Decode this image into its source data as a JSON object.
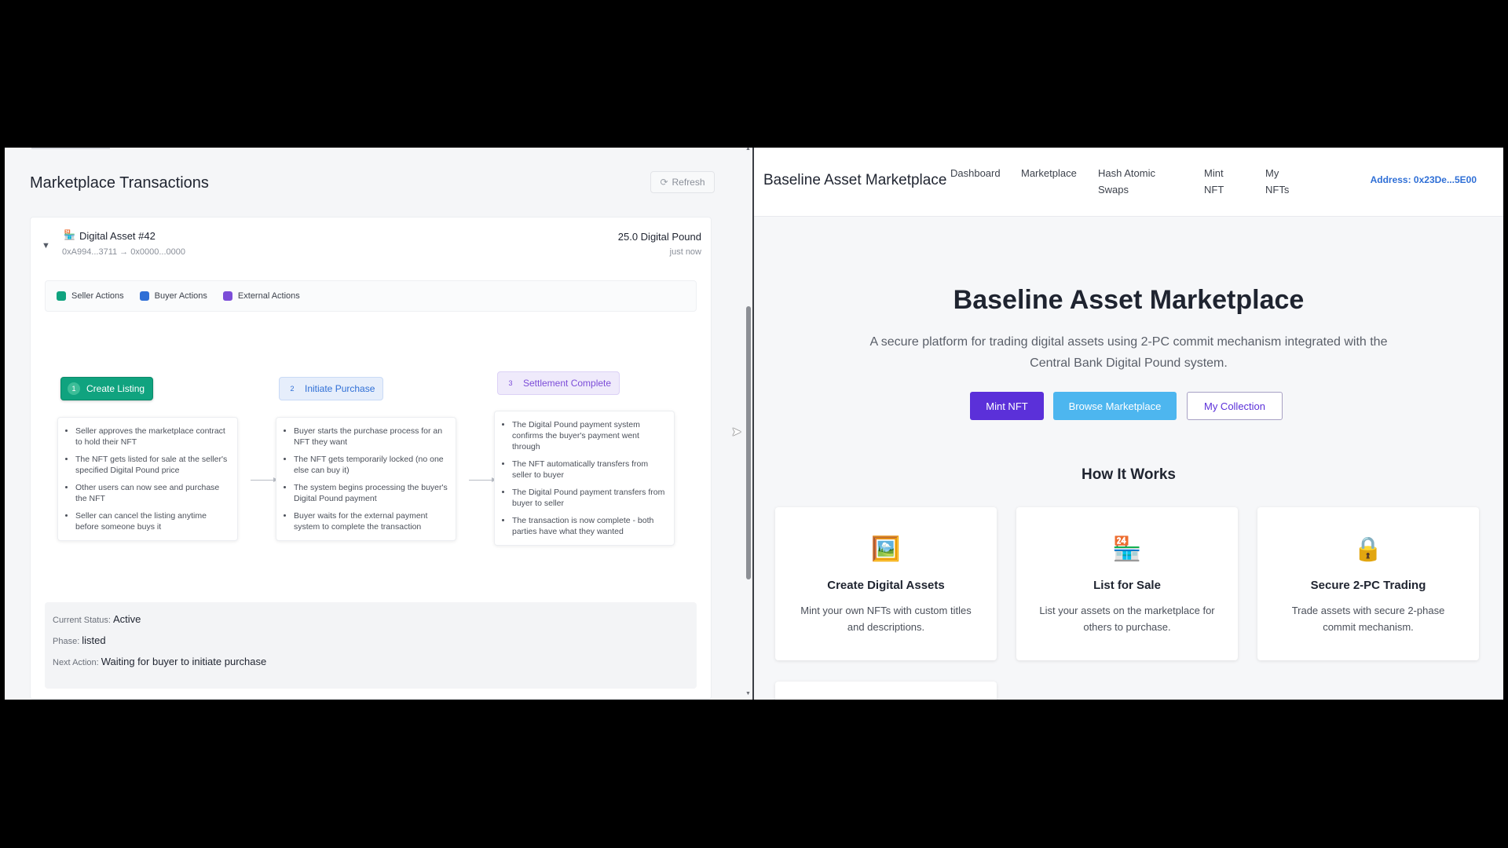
{
  "left": {
    "title": "Marketplace Transactions",
    "refresh_label": "Refresh",
    "transaction": {
      "asset_icon": "storefront-icon",
      "asset_name": "Digital Asset #42",
      "route": "0xA994...3711 → 0x0000...0000",
      "amount": "25.0 Digital Pound",
      "time": "just now"
    },
    "legend": [
      {
        "label": "Seller Actions",
        "color": "#10a37f"
      },
      {
        "label": "Buyer Actions",
        "color": "#2f6fd6"
      },
      {
        "label": "External Actions",
        "color": "#7c4dd8"
      }
    ],
    "steps": [
      {
        "num": "1",
        "label": "Create Listing",
        "items": [
          "Seller approves the marketplace contract to hold their NFT",
          "The NFT gets listed for sale at the seller's specified Digital Pound price",
          "Other users can now see and purchase the NFT",
          "Seller can cancel the listing anytime before someone buys it"
        ]
      },
      {
        "num": "2",
        "label": "Initiate Purchase",
        "items": [
          "Buyer starts the purchase process for an NFT they want",
          "The NFT gets temporarily locked (no one else can buy it)",
          "The system begins processing the buyer's Digital Pound payment",
          "Buyer waits for the external payment system to complete the transaction"
        ]
      },
      {
        "num": "3",
        "label": "Settlement Complete",
        "items": [
          "The Digital Pound payment system confirms the buyer's payment went through",
          "The NFT automatically transfers from seller to buyer",
          "The Digital Pound payment transfers from buyer to seller",
          "The transaction is now complete - both parties have what they wanted"
        ]
      }
    ],
    "status": {
      "current_label": "Current Status:",
      "current_value": "Active",
      "phase_label": "Phase:",
      "phase_value": "listed",
      "next_label": "Next Action:",
      "next_value": "Waiting for buyer to initiate purchase"
    }
  },
  "right": {
    "brand": "Baseline Asset Marketplace",
    "nav": {
      "dashboard": "Dashboard",
      "marketplace": "Marketplace",
      "hash_atomic_swaps": "Hash Atomic Swaps",
      "mint_nft": "Mint NFT",
      "my_nfts": "My NFTs"
    },
    "address": "Address: 0x23De...5E00",
    "hero": {
      "title": "Baseline Asset Marketplace",
      "subtitle": "A secure platform for trading digital assets using 2-PC commit mechanism integrated with the Central Bank Digital Pound system.",
      "buttons": {
        "mint": "Mint NFT",
        "browse": "Browse Marketplace",
        "collection": "My Collection"
      }
    },
    "how_title": "How It Works",
    "features": [
      {
        "icon": "framed-picture-icon",
        "title": "Create Digital Assets",
        "desc": "Mint your own NFTs with custom titles and descriptions."
      },
      {
        "icon": "storefront-icon",
        "title": "List for Sale",
        "desc": "List your assets on the marketplace for others to purchase."
      },
      {
        "icon": "lock-icon",
        "title": "Secure 2-PC Trading",
        "desc": "Trade assets with secure 2-phase commit mechanism."
      }
    ]
  },
  "colors": {
    "seller": "#10a37f",
    "buyer": "#2f6fd6",
    "external": "#7c4dd8",
    "brand_purple": "#5b30d9",
    "browse_blue": "#4db6ef",
    "address_blue": "#2f6fd6"
  }
}
